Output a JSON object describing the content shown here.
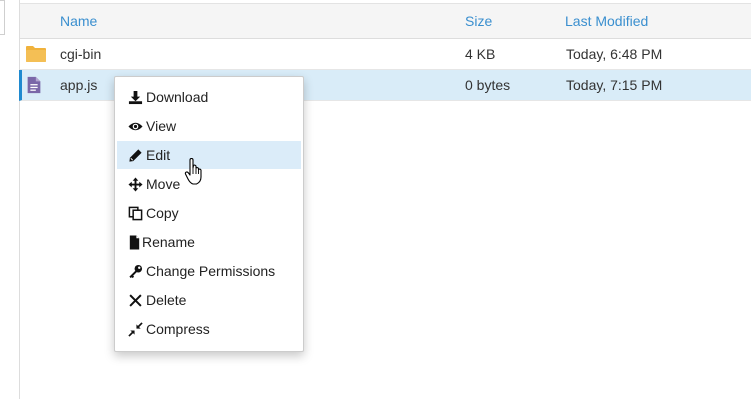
{
  "table": {
    "headers": {
      "name": "Name",
      "size": "Size",
      "modified": "Last Modified"
    },
    "rows": [
      {
        "name": "cgi-bin",
        "size": "4 KB",
        "modified": "Today, 6:48 PM",
        "icon": "folder-icon",
        "selected": false
      },
      {
        "name": "app.js",
        "size": "0 bytes",
        "modified": "Today, 7:15 PM",
        "icon": "document-icon",
        "selected": true
      }
    ]
  },
  "context_menu": {
    "items": [
      {
        "label": "Download",
        "icon": "download-icon"
      },
      {
        "label": "View",
        "icon": "eye-icon"
      },
      {
        "label": "Edit",
        "icon": "pencil-icon",
        "hovered": true
      },
      {
        "label": "Move",
        "icon": "move-arrows-icon"
      },
      {
        "label": "Copy",
        "icon": "copy-icon"
      },
      {
        "label": "Rename",
        "icon": "file-icon"
      },
      {
        "label": "Change Permissions",
        "icon": "key-icon"
      },
      {
        "label": "Delete",
        "icon": "x-icon"
      },
      {
        "label": "Compress",
        "icon": "compress-icon"
      }
    ]
  },
  "colors": {
    "link": "#3a8fcf",
    "folder": "#f0b23c",
    "document": "#7a67a8",
    "selected_row": "#d9ecf8",
    "hover_item": "#dbecf9"
  }
}
